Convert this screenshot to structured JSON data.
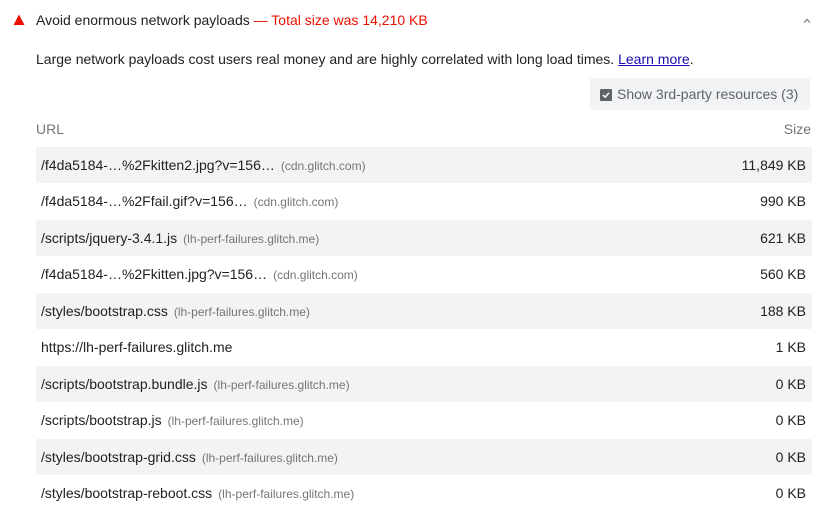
{
  "audit": {
    "title": "Avoid enormous network payloads",
    "display_value": " — Total size was 14,210 KB",
    "description_text": "Large network payloads cost users real money and are highly correlated with long load times. ",
    "learn_more": "Learn more",
    "status_color": "#eb0f00",
    "status_icon": "warning-triangle-icon"
  },
  "third_party": {
    "label": "Show 3rd-party resources (3)",
    "checked": true
  },
  "table": {
    "headers": {
      "url": "URL",
      "size": "Size"
    },
    "rows": [
      {
        "url": "/f4da5184-…%2Fkitten2.jpg?v=156…",
        "origin": "(cdn.glitch.com)",
        "size": "11,849 KB"
      },
      {
        "url": "/f4da5184-…%2Ffail.gif?v=156…",
        "origin": "(cdn.glitch.com)",
        "size": "990 KB"
      },
      {
        "url": "/scripts/jquery-3.4.1.js",
        "origin": "(lh-perf-failures.glitch.me)",
        "size": "621 KB"
      },
      {
        "url": "/f4da5184-…%2Fkitten.jpg?v=156…",
        "origin": "(cdn.glitch.com)",
        "size": "560 KB"
      },
      {
        "url": "/styles/bootstrap.css",
        "origin": "(lh-perf-failures.glitch.me)",
        "size": "188 KB"
      },
      {
        "url": "https://lh-perf-failures.glitch.me",
        "origin": "",
        "size": "1 KB"
      },
      {
        "url": "/scripts/bootstrap.bundle.js",
        "origin": "(lh-perf-failures.glitch.me)",
        "size": "0 KB"
      },
      {
        "url": "/scripts/bootstrap.js",
        "origin": "(lh-perf-failures.glitch.me)",
        "size": "0 KB"
      },
      {
        "url": "/styles/bootstrap-grid.css",
        "origin": "(lh-perf-failures.glitch.me)",
        "size": "0 KB"
      },
      {
        "url": "/styles/bootstrap-reboot.css",
        "origin": "(lh-perf-failures.glitch.me)",
        "size": "0 KB"
      }
    ]
  }
}
